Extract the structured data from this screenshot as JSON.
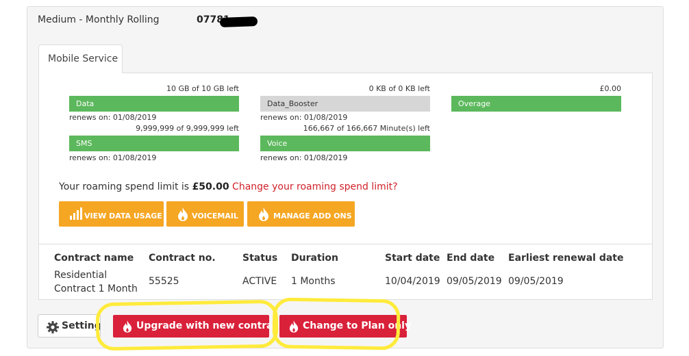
{
  "header": {
    "plan_name": "Medium - Monthly Rolling",
    "phone_number_visible": "07781"
  },
  "tabs": [
    {
      "label": "Mobile Service",
      "active": true
    }
  ],
  "allowances": [
    {
      "quantity": "10 GB of 10 GB left",
      "name": "Data",
      "renews": "renews on: 01/08/2019",
      "color": "#5cb85c"
    },
    {
      "quantity": "0 KB of 0 KB left",
      "name": "Data_Booster",
      "renews": "renews on: 01/08/2019",
      "color": "#d6d6d6"
    },
    {
      "quantity": "£0.00",
      "name": "Overage",
      "renews": "",
      "color": "#5cb85c"
    },
    {
      "quantity": "9,999,999 of 9,999,999 left",
      "name": "SMS",
      "renews": "renews on: 01/08/2019",
      "color": "#5cb85c"
    },
    {
      "quantity": "166,667 of 166,667 Minute(s) left",
      "name": "Voice",
      "renews": "renews on: 01/08/2019",
      "color": "#5cb85c"
    }
  ],
  "roaming": {
    "prefix": "Your roaming spend limit is",
    "amount": "£50.00",
    "link": "Change your roaming spend limit?"
  },
  "actions": {
    "view_data_usage": "VIEW DATA USAGE",
    "voicemail": "VOICEMAIL",
    "manage_add_ons": "MANAGE ADD ONS"
  },
  "contract_table": {
    "headers": [
      "Contract name",
      "Contract no.",
      "Status",
      "Duration",
      "Start date",
      "End date",
      "Earliest renewal date"
    ],
    "row": {
      "name_line1": "Residential",
      "name_line2": "Contract 1 Month",
      "number": "55525",
      "status": "ACTIVE",
      "duration": "1 Months",
      "start_date": "10/04/2019",
      "end_date": "09/05/2019",
      "earliest_renewal": "09/05/2019"
    }
  },
  "footer": {
    "settings_label": "Settings",
    "upgrade_label": "Upgrade with new contract",
    "change_plan_label": "Change to Plan only"
  },
  "colors": {
    "allowance_green": "#5cb85c",
    "action_orange": "#f5a623",
    "primary_red": "#d9213a",
    "link_red": "#d0222a",
    "highlight_yellow": "#ffeb3b"
  }
}
